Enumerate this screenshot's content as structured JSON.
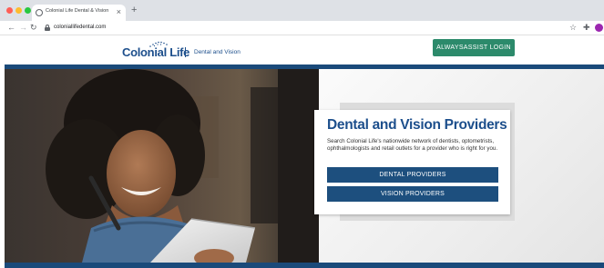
{
  "browser": {
    "tab_title": "Colonial Life Dental & Vision",
    "tab_close": "×",
    "new_tab": "+",
    "url": "coloniallifedental.com",
    "back": "←",
    "forward": "→",
    "reload": "↻",
    "star": "☆",
    "extensions": "✚"
  },
  "header": {
    "logo_text": "Colonial Life",
    "subtitle": "Dental and Vision",
    "login_label": "ALWAYSASSIST LOGIN"
  },
  "hero": {
    "title": "Dental and Vision Providers",
    "description": "Search Colonial Life's nationwide network of dentists, optometrists, ophthalmologists and retail outlets for a provider who is right for you.",
    "dental_button": "DENTAL PROVIDERS",
    "vision_button": "VISION PROVIDERS"
  },
  "colors": {
    "brand_blue": "#1d4f8c",
    "band_blue": "#1a4a7a",
    "login_green": "#2c8a6b",
    "button_blue": "#1d4f7e"
  }
}
